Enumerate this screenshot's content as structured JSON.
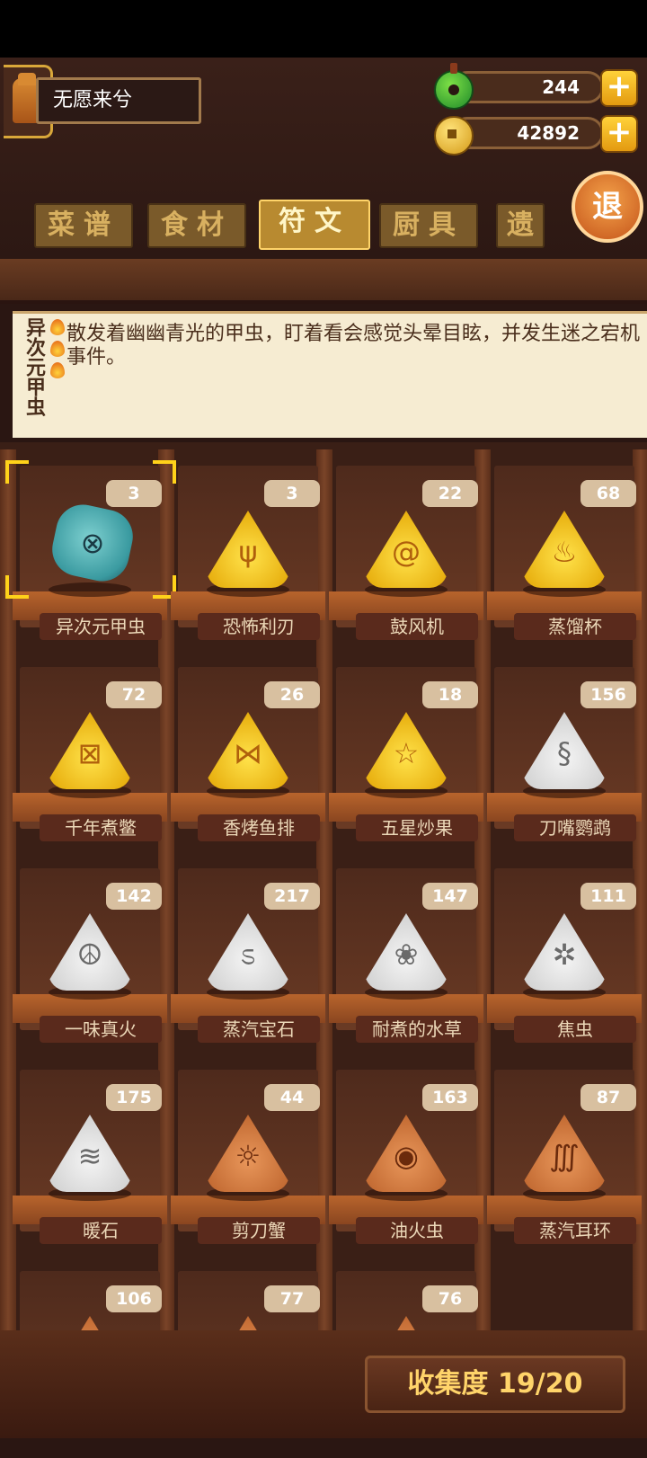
{
  "player": {
    "name": "无愿来兮"
  },
  "resources": {
    "jade": "244",
    "coins": "42892",
    "plus": "+"
  },
  "exit_label": "退",
  "tabs": [
    {
      "label": "菜谱",
      "active": false
    },
    {
      "label": "食材",
      "active": false
    },
    {
      "label": "符文",
      "active": true
    },
    {
      "label": "厨具",
      "active": false
    },
    {
      "label": "遗",
      "active": false
    }
  ],
  "detail": {
    "title": "异次元甲虫",
    "text": "散发着幽幽青光的甲虫，盯着看会感觉头晕目眩，并发生迷之宕机事件。",
    "flame_count": 3
  },
  "runes": [
    {
      "name": "异次元甲虫",
      "count": "3",
      "tier": "jade",
      "glyph": "⊗",
      "selected": true
    },
    {
      "name": "恐怖利刃",
      "count": "3",
      "tier": "gold",
      "glyph": "ψ"
    },
    {
      "name": "鼓风机",
      "count": "22",
      "tier": "gold",
      "glyph": "@"
    },
    {
      "name": "蒸馏杯",
      "count": "68",
      "tier": "gold",
      "glyph": "♨"
    },
    {
      "name": "千年煮鳖",
      "count": "72",
      "tier": "gold",
      "glyph": "⊠"
    },
    {
      "name": "香烤鱼排",
      "count": "26",
      "tier": "gold",
      "glyph": "⋈"
    },
    {
      "name": "五星炒果",
      "count": "18",
      "tier": "gold",
      "glyph": "☆"
    },
    {
      "name": "刀嘴鹦鹉",
      "count": "156",
      "tier": "silver",
      "glyph": "§"
    },
    {
      "name": "一味真火",
      "count": "142",
      "tier": "silver",
      "glyph": "☮"
    },
    {
      "name": "蒸汽宝石",
      "count": "217",
      "tier": "silver",
      "glyph": "ಽ"
    },
    {
      "name": "耐煮的水草",
      "count": "147",
      "tier": "silver",
      "glyph": "❀"
    },
    {
      "name": "焦虫",
      "count": "111",
      "tier": "silver",
      "glyph": "✲"
    },
    {
      "name": "暖石",
      "count": "175",
      "tier": "silver",
      "glyph": "≋"
    },
    {
      "name": "剪刀蟹",
      "count": "44",
      "tier": "bronze",
      "glyph": "☼"
    },
    {
      "name": "油火虫",
      "count": "163",
      "tier": "bronze",
      "glyph": "◉"
    },
    {
      "name": "蒸汽耳环",
      "count": "87",
      "tier": "bronze",
      "glyph": "∭"
    },
    {
      "name": "",
      "count": "106",
      "tier": "bronze",
      "glyph": "❂"
    },
    {
      "name": "",
      "count": "77",
      "tier": "bronze",
      "glyph": "ʬ"
    },
    {
      "name": "",
      "count": "76",
      "tier": "bronze",
      "glyph": "∽"
    }
  ],
  "collection": {
    "label": "收集度 19/20"
  }
}
